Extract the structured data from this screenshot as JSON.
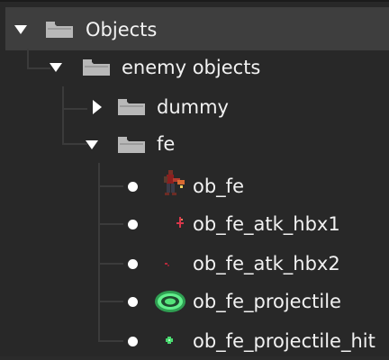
{
  "tree": {
    "root": {
      "label": "Objects",
      "icon": "folder-icon",
      "expanded": true,
      "selected": true,
      "children": {
        "enemy_objects": {
          "label": "enemy objects",
          "icon": "folder-icon",
          "expanded": true,
          "children": {
            "dummy": {
              "label": "dummy",
              "icon": "folder-icon",
              "expanded": false
            },
            "fe": {
              "label": "fe",
              "icon": "folder-icon",
              "expanded": true,
              "objects": [
                {
                  "label": "ob_fe",
                  "sprite": "fe-character-sprite-icon"
                },
                {
                  "label": "ob_fe_atk_hbx1",
                  "sprite": "attack-hitbox-1-sprite-icon"
                },
                {
                  "label": "ob_fe_atk_hbx2",
                  "sprite": "attack-hitbox-2-sprite-icon"
                },
                {
                  "label": "ob_fe_projectile",
                  "sprite": "green-ring-projectile-sprite-icon"
                },
                {
                  "label": "ob_fe_projectile_hit",
                  "sprite": "green-spark-sprite-icon"
                }
              ]
            }
          }
        }
      }
    }
  },
  "colors": {
    "background": "#282828",
    "selection": "#3e3e3e",
    "text": "#f2f2f2",
    "folder": "#b8b8b8",
    "guide": "#3b3b3b",
    "projectile_green": "#48e070"
  }
}
